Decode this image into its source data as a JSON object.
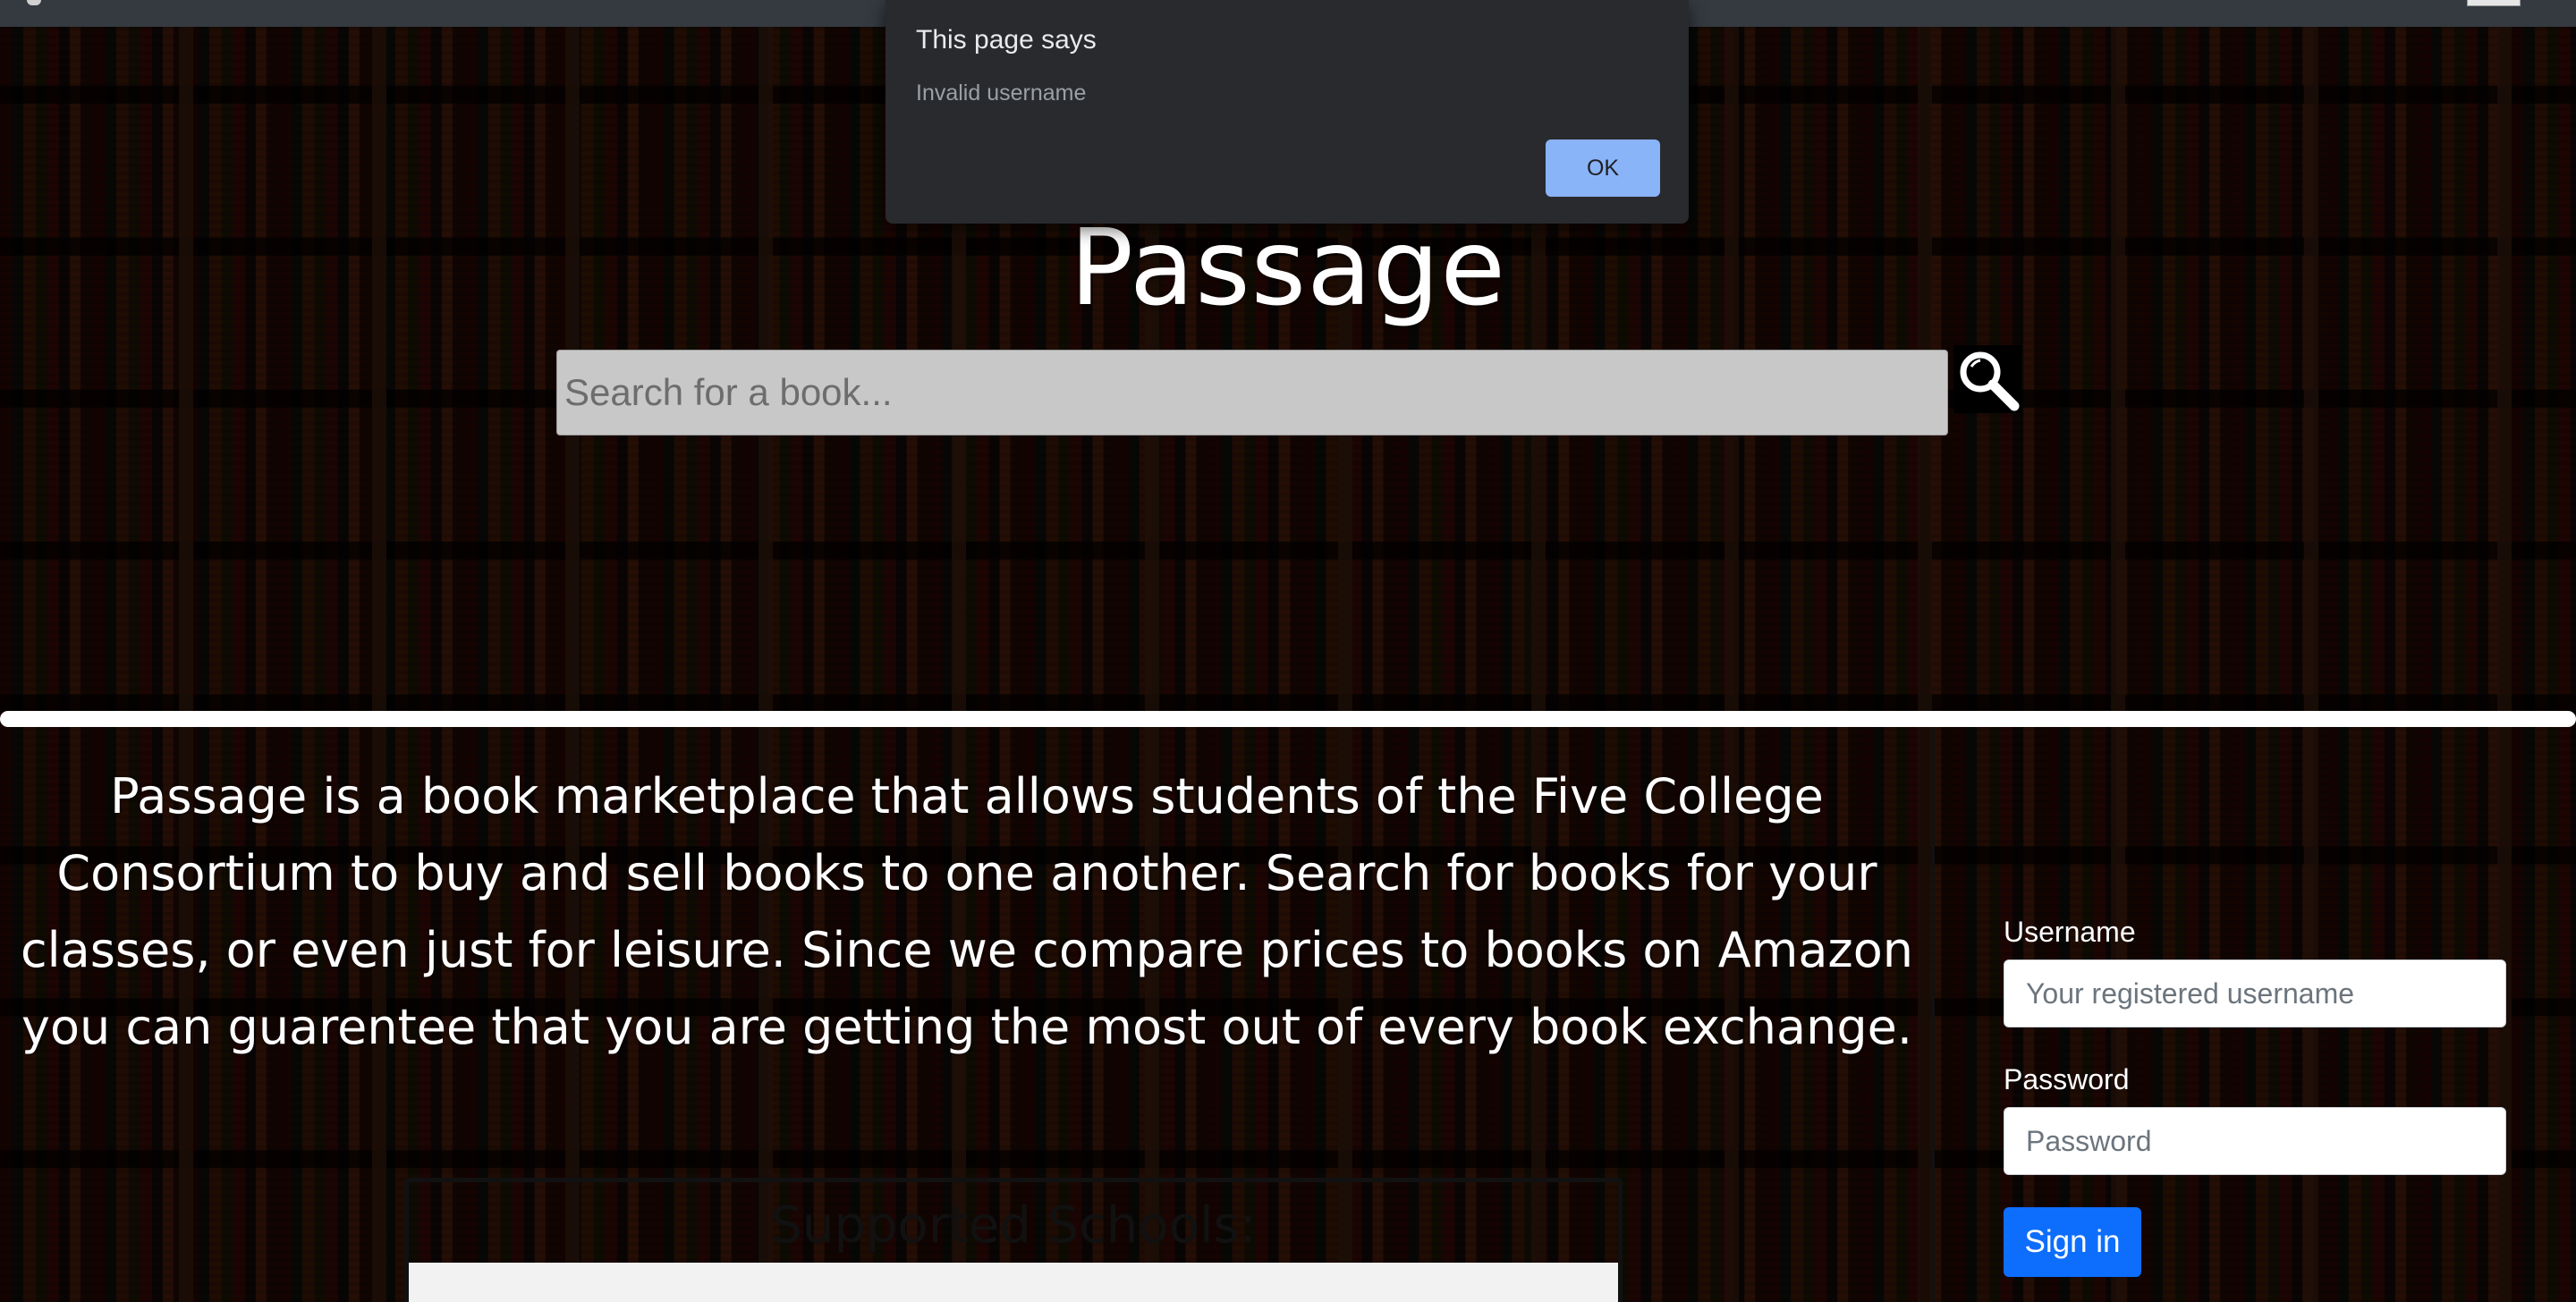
{
  "dialog": {
    "title": "This page says",
    "message": "Invalid username",
    "ok_label": "OK"
  },
  "header": {
    "site_title": "Passage"
  },
  "search": {
    "placeholder": "Search for a book...",
    "button_icon": "search-icon"
  },
  "about": {
    "text": "Passage is a book marketplace that allows students of the Five College Consortium to buy and sell books to one another. Search for books for your classes, or even just for leisure. Since we compare prices to books on Amazon you can guarentee that you are getting the most out of every book exchange."
  },
  "schools": {
    "title": "Supported Schools:"
  },
  "login": {
    "username_label": "Username",
    "username_placeholder": "Your registered username",
    "password_label": "Password",
    "password_placeholder": "Password",
    "sign_in_label": "Sign in"
  },
  "colors": {
    "topbar": "#343a40",
    "dialog_bg": "#292a2d",
    "dialog_button": "#8ab4f8",
    "primary_button": "#0d6efd"
  }
}
